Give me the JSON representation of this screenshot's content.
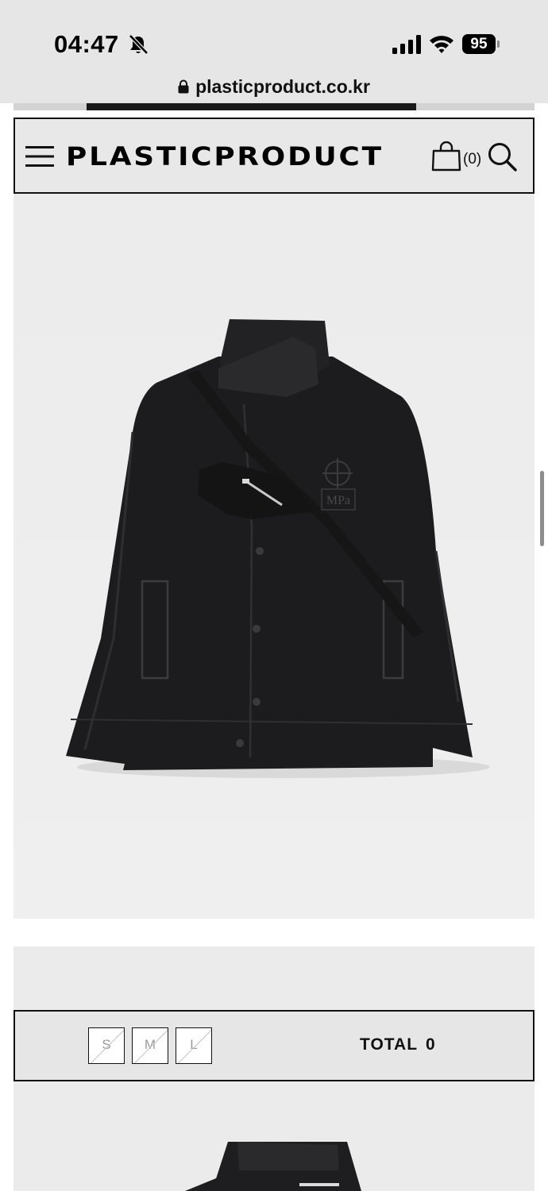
{
  "status_bar": {
    "time": "04:47",
    "battery": "95",
    "icons": [
      "bell-slash-icon",
      "signal-icon",
      "wifi-icon",
      "battery-icon"
    ]
  },
  "browser": {
    "url": "plasticproduct.co.kr",
    "lock_icon": "lock-icon"
  },
  "header": {
    "brand": "PLASTICPRODUCT",
    "cart_count": "(0)",
    "icons": [
      "hamburger-menu-icon",
      "shopping-bag-icon",
      "search-icon"
    ]
  },
  "product": {
    "chest_logo_text": "MPa"
  },
  "size_bar": {
    "sizes": [
      "S",
      "M",
      "L"
    ],
    "total_label": "TOTAL",
    "total_value": "0"
  },
  "colors": {
    "header_bg": "#e8e8e8",
    "border": "#111111",
    "image_bg": "#ededed",
    "jacket": "#1c1c1e"
  }
}
